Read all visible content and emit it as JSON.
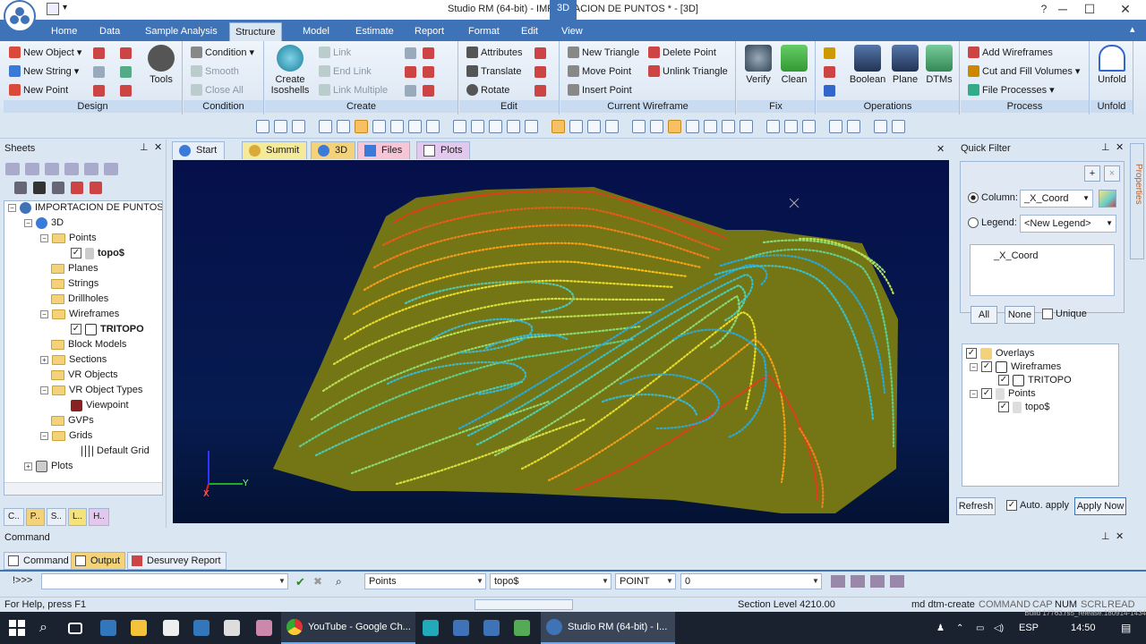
{
  "window": {
    "title": "Studio RM (64-bit) - IMPORTACION DE PUNTOS * - [3D]",
    "context_tab": "3D"
  },
  "ribbon": {
    "tabs": [
      "Home",
      "Data",
      "Sample Analysis",
      "Structure",
      "Model",
      "Estimate",
      "Report",
      "Format",
      "Edit",
      "View"
    ],
    "active_tab": "Structure",
    "groups": {
      "design": {
        "name": "Design",
        "new_object": "New Object",
        "new_string": "New String",
        "new_point": "New Point",
        "tools": "Tools"
      },
      "condition": {
        "name": "Condition",
        "condition": "Condition",
        "smooth": "Smooth",
        "close_all": "Close All"
      },
      "create": {
        "name": "Create",
        "link": "Link",
        "end_link": "End Link",
        "link_multiple": "Link Multiple",
        "create_isoshells": "Create Isoshells"
      },
      "edit": {
        "name": "Edit",
        "attributes": "Attributes",
        "translate": "Translate",
        "rotate": "Rotate"
      },
      "current_wireframe": {
        "name": "Current Wireframe",
        "new_triangle": "New Triangle",
        "move_point": "Move Point",
        "insert_point": "Insert Point",
        "delete_point": "Delete Point",
        "unlink_triangle": "Unlink Triangle"
      },
      "fix": {
        "name": "Fix",
        "verify": "Verify",
        "clean": "Clean"
      },
      "operations": {
        "name": "Operations",
        "boolean": "Boolean",
        "plane": "Plane",
        "dtms": "DTMs"
      },
      "process": {
        "name": "Process",
        "add_wireframes": "Add Wireframes",
        "cut_fill": "Cut and Fill Volumes",
        "file_processes": "File Processes"
      },
      "unfold": {
        "name": "Unfold",
        "unfold": "Unfold"
      }
    }
  },
  "sheets": {
    "title": "Sheets",
    "root": "IMPORTACION DE PUNTOS",
    "nodes": {
      "n3d": "3D",
      "points": "Points",
      "topo": "topo$",
      "planes": "Planes",
      "strings": "Strings",
      "drillholes": "Drillholes",
      "wireframes": "Wireframes",
      "tritopo": "TRITOPO",
      "block_models": "Block Models",
      "sections": "Sections",
      "vr_objects": "VR Objects",
      "vr_object_types": "VR Object Types",
      "viewpoint": "Viewpoint",
      "gvps": "GVPs",
      "grids": "Grids",
      "default_grid": "Default Grid",
      "plots": "Plots"
    },
    "bottom_tabs": [
      "C..",
      "P..",
      "S..",
      "L..",
      "H.."
    ]
  },
  "viewport": {
    "tabs": [
      "Start",
      "Summit",
      "3D",
      "Files",
      "Plots"
    ],
    "active_tab": "3D",
    "axis_y": "Y",
    "axis_x": "X"
  },
  "quick_filter": {
    "title": "Quick Filter",
    "side_tab": "Properties",
    "column_label": "Column:",
    "column_value": "_X_Coord",
    "legend_label": "Legend:",
    "legend_value": "<New Legend>",
    "list_value": "_X_Coord",
    "all_btn": "All",
    "none_btn": "None",
    "unique_label": "Unique",
    "overlays": {
      "root": "Overlays",
      "wireframes": "Wireframes",
      "tritopo": "TRITOPO",
      "points": "Points",
      "topo": "topo$"
    },
    "refresh_btn": "Refresh",
    "auto_apply": "Auto. apply",
    "apply_now": "Apply Now"
  },
  "command": {
    "title": "Command",
    "tabs": [
      "Command",
      "Output",
      "Desurvey Report"
    ],
    "prompt": "!>>>",
    "object_type": "Points",
    "object_name": "topo$",
    "attr_type": "POINT",
    "value": "0"
  },
  "status": {
    "help": "For Help, press F1",
    "section_level": "Section Level 4210.00",
    "last_cmd": "md dtm-create",
    "indicators": [
      "COMMAND",
      "CAP",
      "NUM",
      "SCRL",
      "READ"
    ],
    "build": "Build 17763.rs5_release.180914-1434"
  },
  "taskbar": {
    "apps": [
      {
        "label": "YouTube - Google Ch...",
        "icon": "chrome-icon"
      },
      {
        "label": "Studio RM (64-bit) - I...",
        "icon": "studio-rm-icon"
      }
    ],
    "lang": "ESP",
    "time": "14:50"
  },
  "colors": {
    "accent": "#3f73b8",
    "surface": "#7a7a12",
    "contour_hi": "#e02020",
    "contour_lo": "#2aa9d8"
  }
}
